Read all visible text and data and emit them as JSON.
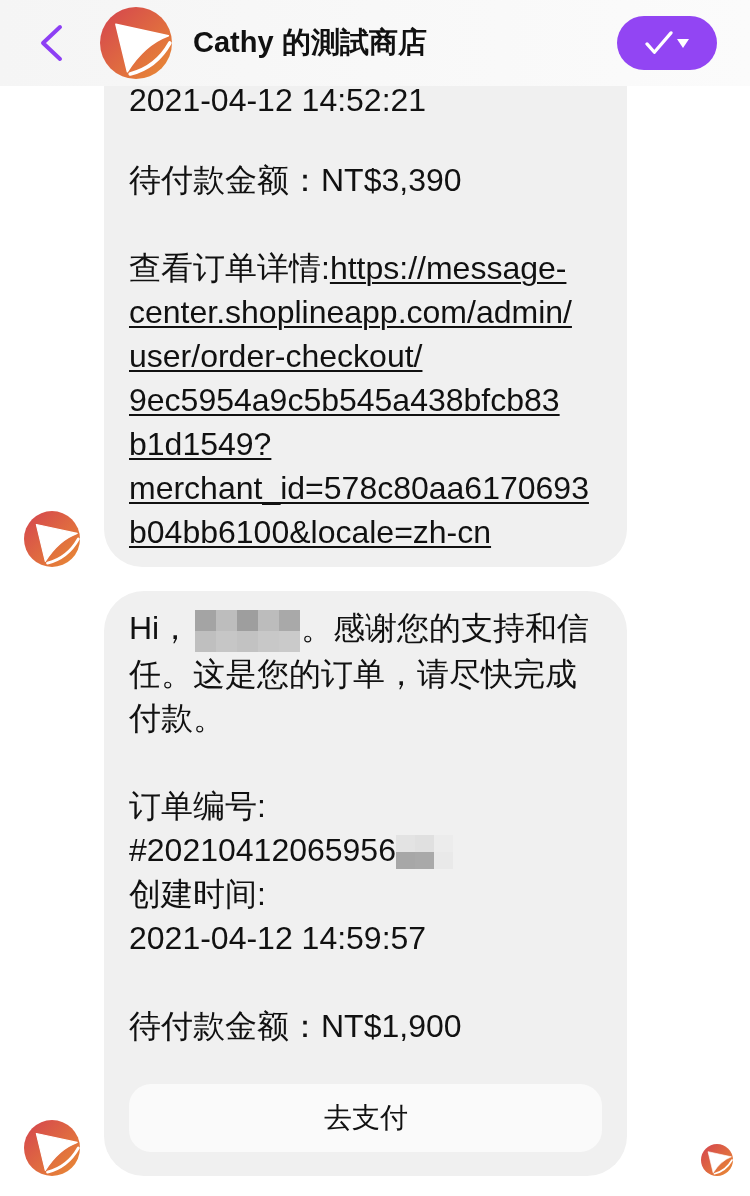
{
  "header": {
    "title": "Cathy 的測試商店"
  },
  "messages": [
    {
      "clipped_top": true,
      "seen": false,
      "blocks": [
        {
          "lines": [
            {
              "segments": [
                {
                  "kind": "text",
                  "text": "2021-04-12 14:52:21"
                }
              ]
            }
          ]
        },
        {
          "lines": [
            {
              "segments": [
                {
                  "kind": "text",
                  "text": "待付款金额：NT$3,390"
                }
              ]
            }
          ]
        },
        {
          "lines": [
            {
              "segments": [
                {
                  "kind": "text",
                  "text": "查看订单详情:"
                },
                {
                  "kind": "link",
                  "text": "https://message-"
                }
              ]
            },
            {
              "segments": [
                {
                  "kind": "link",
                  "text": "center.shoplineapp.com/admin/"
                }
              ]
            },
            {
              "segments": [
                {
                  "kind": "link",
                  "text": "user/order-checkout/"
                }
              ]
            },
            {
              "segments": [
                {
                  "kind": "link",
                  "text": "9ec5954a9c5b545a438bfcb83"
                }
              ]
            },
            {
              "segments": [
                {
                  "kind": "link",
                  "text": "b1d1549?"
                }
              ]
            },
            {
              "segments": [
                {
                  "kind": "link",
                  "text": "merchant_id=578c80aa6170693"
                }
              ]
            },
            {
              "segments": [
                {
                  "kind": "link",
                  "text": "b04bb6100&locale=zh-cn"
                }
              ]
            }
          ]
        }
      ]
    },
    {
      "clipped_top": false,
      "seen": true,
      "blocks": [
        {
          "lines": [
            {
              "segments": [
                {
                  "kind": "text",
                  "text": "Hi，"
                },
                {
                  "kind": "mosaic"
                },
                {
                  "kind": "text",
                  "text": "。感谢您的支持和信任。这是您的订单，请尽快完成付款。"
                }
              ]
            }
          ]
        },
        {
          "lines": [
            {
              "segments": [
                {
                  "kind": "text",
                  "text": "订单编号:"
                }
              ]
            },
            {
              "segments": [
                {
                  "kind": "text",
                  "text": "#20210412065956"
                },
                {
                  "kind": "mosaic"
                }
              ]
            },
            {
              "segments": [
                {
                  "kind": "text",
                  "text": "创建时间:"
                }
              ]
            },
            {
              "segments": [
                {
                  "kind": "text",
                  "text": "2021-04-12 14:59:57"
                }
              ]
            }
          ]
        },
        {
          "lines": [
            {
              "segments": [
                {
                  "kind": "text",
                  "text": "待付款金额：NT$1,900"
                }
              ]
            }
          ]
        }
      ],
      "button": "去支付"
    }
  ]
}
